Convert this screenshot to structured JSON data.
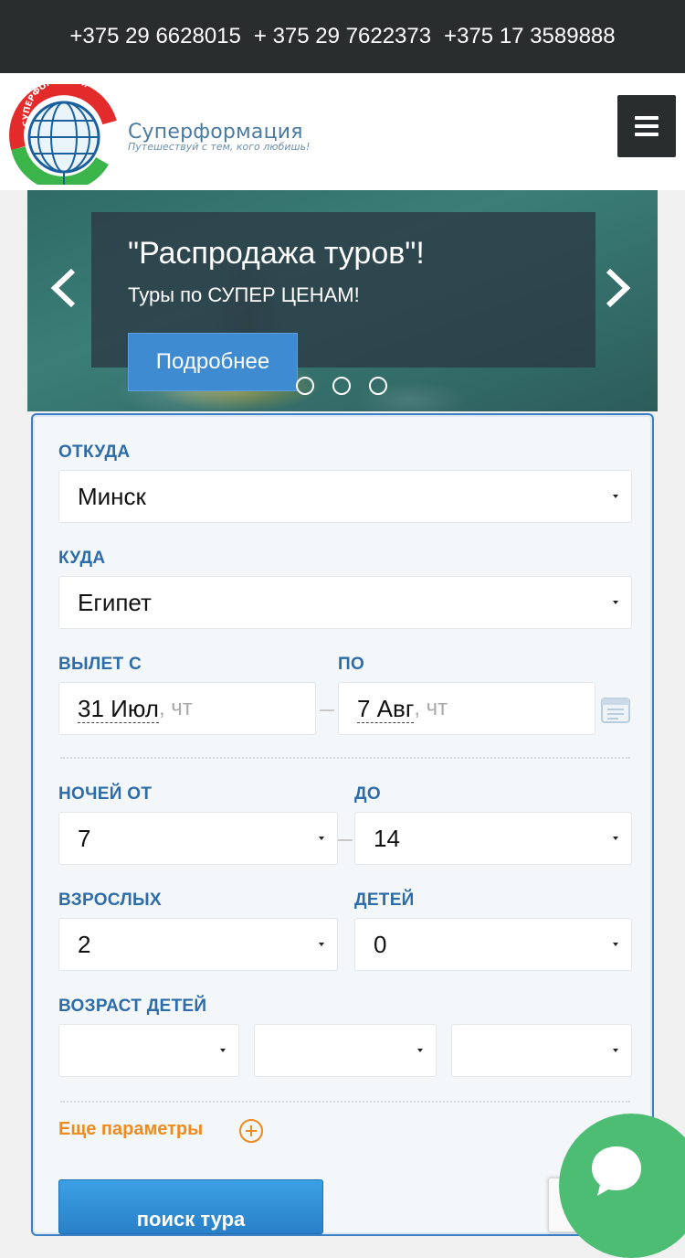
{
  "topbar": {
    "phones": [
      "+375 29 6628015",
      "+ 375 29 7622373",
      "+375 17 3589888"
    ]
  },
  "header": {
    "logo_text": "СУПЕРФОРМАЦИЯ",
    "brand_name": "Суперформация",
    "tagline": "Путешествуй с тем, кого любишь!"
  },
  "slider": {
    "title": "\"Распродажа туров\"!",
    "subtitle": "Туры по СУПЕР ЦЕНАМ!",
    "button": "Подробнее",
    "slides": 3
  },
  "form": {
    "from_label": "ОТКУДА",
    "from_value": "Минск",
    "to_label": "КУДА",
    "to_value": "Египет",
    "depart_label": "ВЫЛЕТ С",
    "depart_date": "31 Июл",
    "depart_day": ", чт",
    "until_label": "ПО",
    "until_date": "7 Авг",
    "until_day": ", чт",
    "nights_from_label": "НОЧЕЙ ОТ",
    "nights_from_value": "7",
    "nights_to_label": "ДО",
    "nights_to_value": "14",
    "adults_label": "ВЗРОСЛЫХ",
    "adults_value": "2",
    "children_label": "ДЕТЕЙ",
    "children_value": "0",
    "child_age_label": "ВОЗРАСТ ДЕТЕЙ",
    "more_params": "Еще параметры",
    "search_button": "поиск тура"
  },
  "colors": {
    "topbar_bg": "#2a2d2e",
    "label_blue": "#2d6ca8",
    "accent_orange": "#f08a1c",
    "button_blue": "#3f8bd2",
    "chat_green": "#4dbd74"
  }
}
